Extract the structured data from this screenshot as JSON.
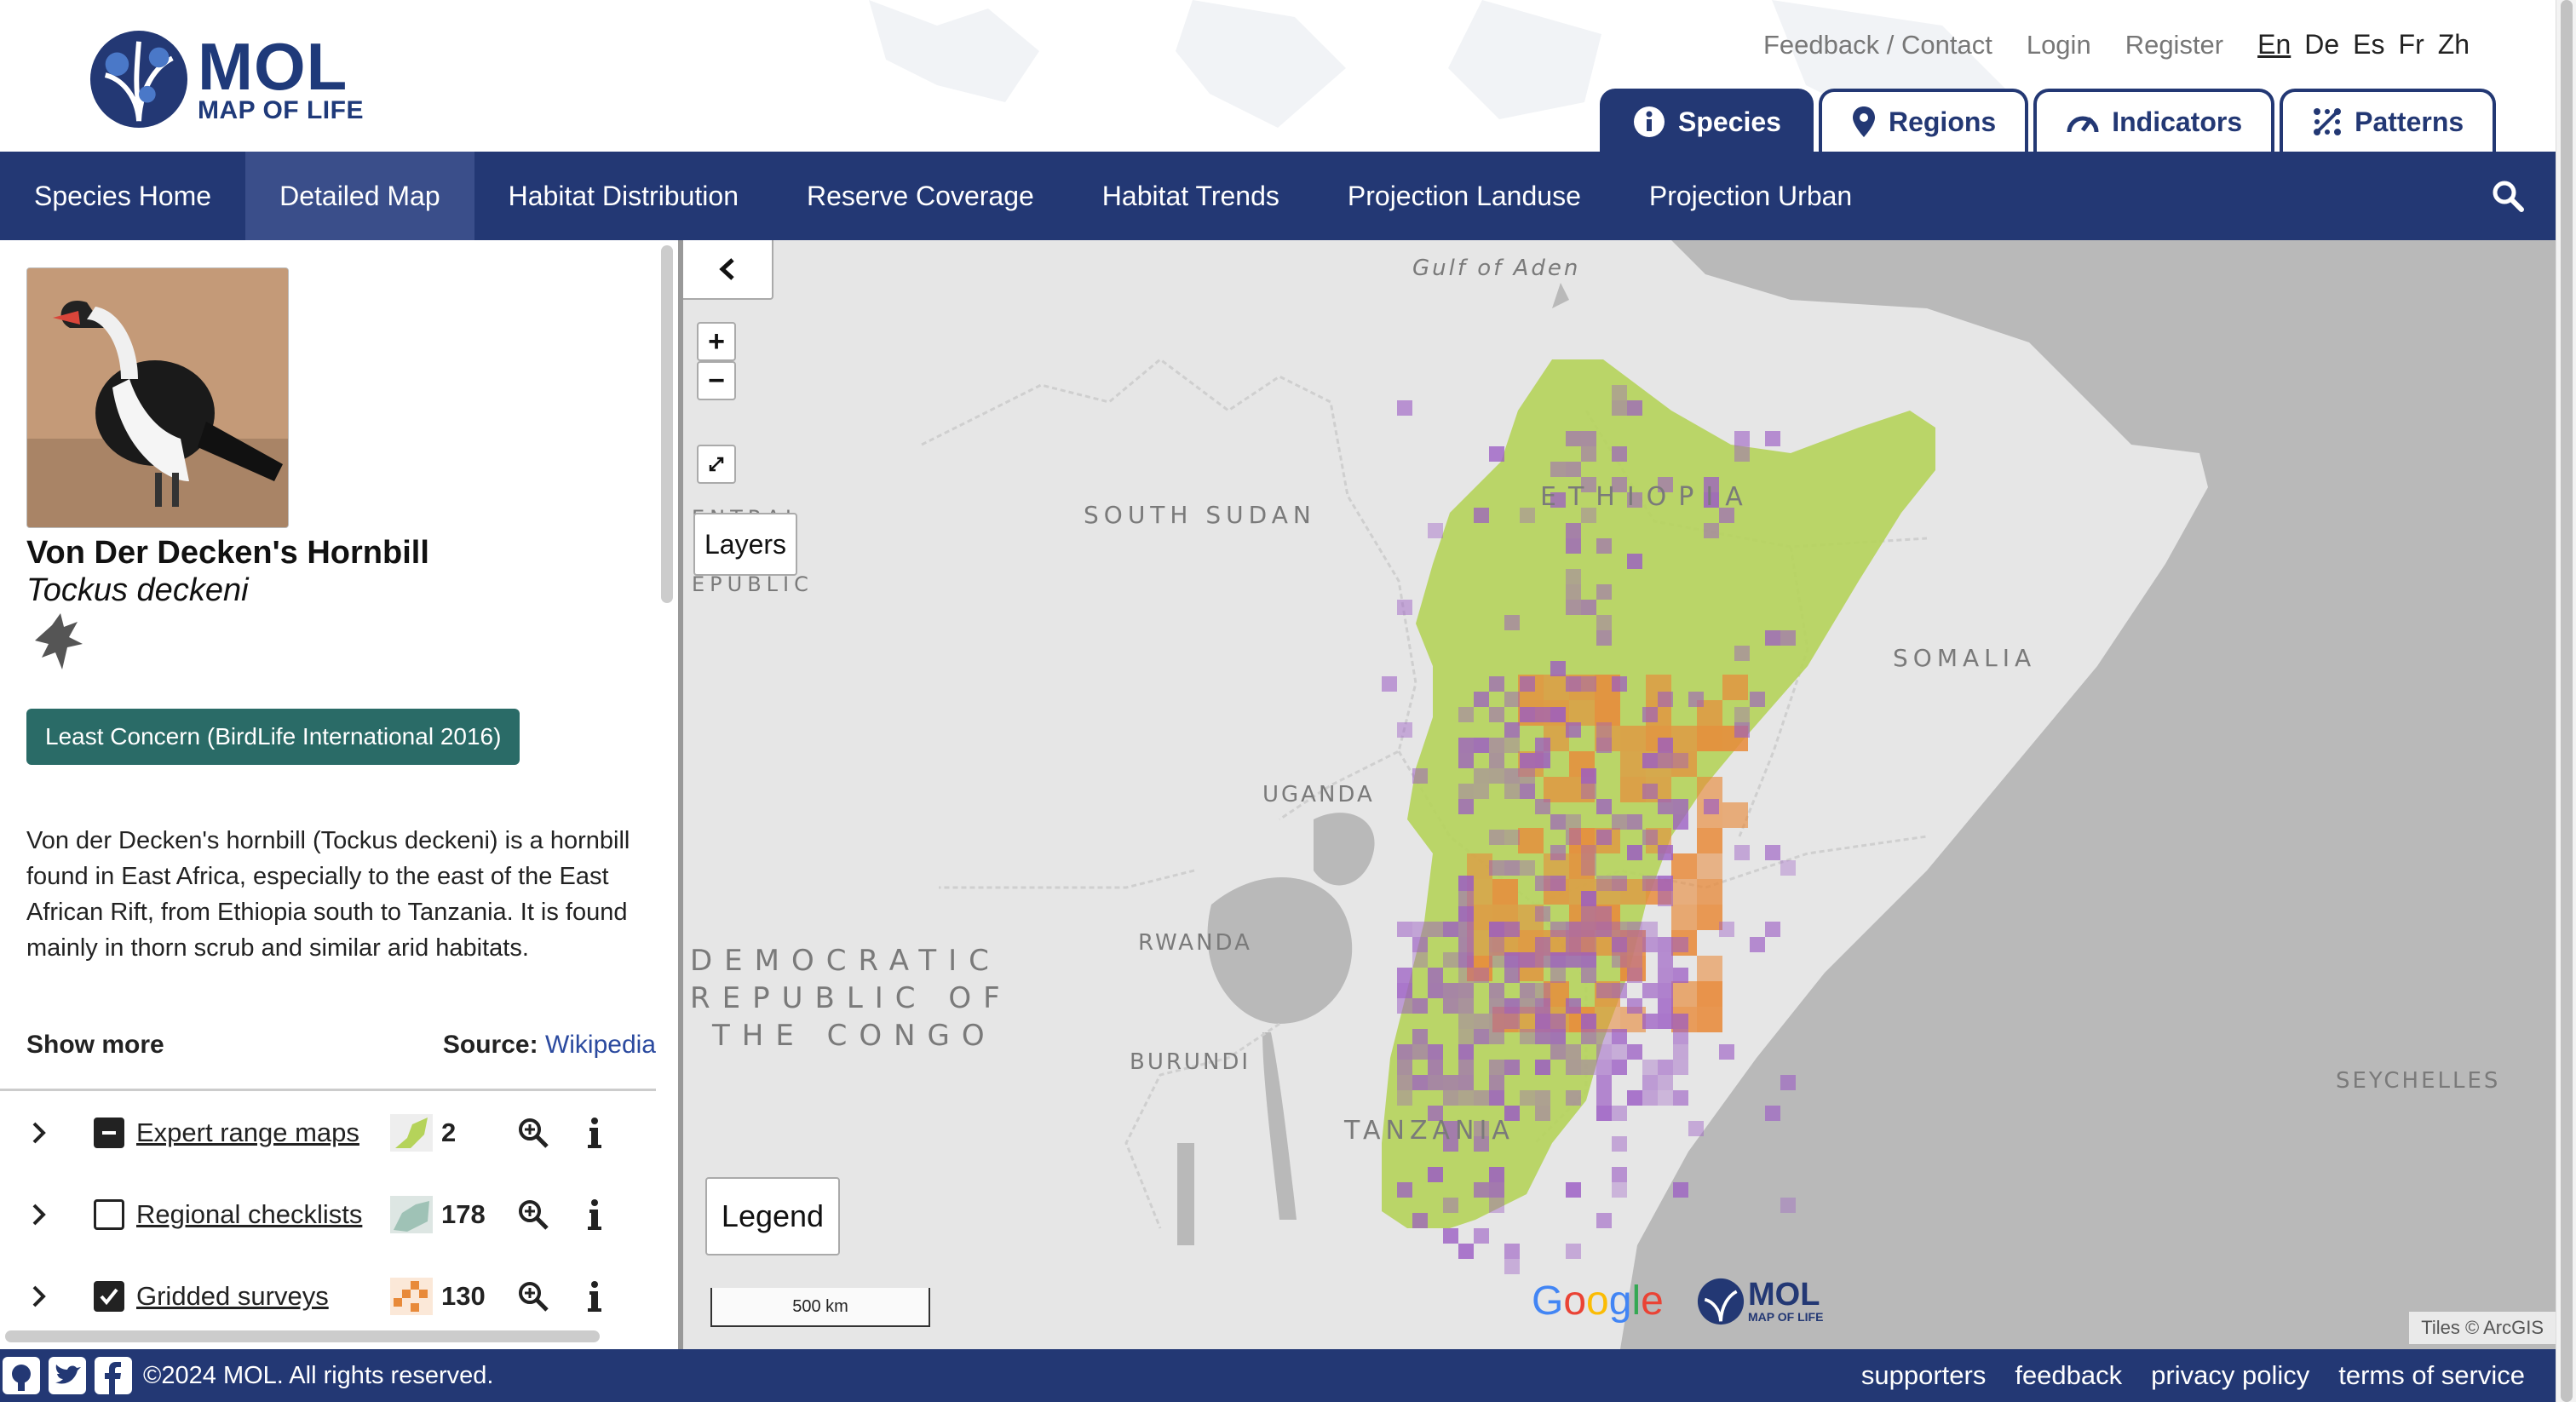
{
  "header": {
    "logo_title": "MOL",
    "logo_subtitle": "MAP OF LIFE",
    "links": [
      "Feedback / Contact",
      "Login",
      "Register"
    ],
    "languages": [
      "En",
      "De",
      "Es",
      "Fr",
      "Zh"
    ],
    "active_language": "En",
    "tabs": [
      {
        "label": "Species",
        "icon": "info-icon",
        "active": true
      },
      {
        "label": "Regions",
        "icon": "map-pin-icon",
        "active": false
      },
      {
        "label": "Indicators",
        "icon": "gauge-icon",
        "active": false
      },
      {
        "label": "Patterns",
        "icon": "patterns-icon",
        "active": false
      }
    ]
  },
  "nav": {
    "items": [
      "Species Home",
      "Detailed Map",
      "Habitat Distribution",
      "Reserve Coverage",
      "Habitat Trends",
      "Projection Landuse",
      "Projection Urban"
    ],
    "active": "Detailed Map"
  },
  "species": {
    "common_name": "Von Der Decken's Hornbill",
    "scientific_name": "Tockus deckeni",
    "status": "Least Concern (BirdLife International 2016)",
    "description": "Von der Decken's hornbill (Tockus deckeni) is a hornbill found in East Africa, especially to the east of the East African Rift, from Ethiopia south to Tanzania. It is found mainly in thorn scrub and similar arid habitats.",
    "show_more": "Show more",
    "source_label": "Source:",
    "source_link": "Wikipedia"
  },
  "layers": [
    {
      "name": "Expert range maps",
      "count": "2",
      "state": "indeterminate"
    },
    {
      "name": "Regional checklists",
      "count": "178",
      "state": "unchecked"
    },
    {
      "name": "Gridded surveys",
      "count": "130",
      "state": "checked"
    }
  ],
  "map": {
    "labels": {
      "south_sudan": "SOUTH SUDAN",
      "ethiopia": "ETHIOPIA",
      "somalia": "SOMALIA",
      "uganda": "UGANDA",
      "rwanda": "RWANDA",
      "burundi": "BURUNDI",
      "drc1": "DEMOCRATIC",
      "drc2": "REPUBLIC OF",
      "drc3": "THE CONGO",
      "tanzania": "TANZANIA",
      "seychelles": "SEYCHELLES",
      "gulf": "Gulf of Aden",
      "car1": "ENTRAL",
      "car2": "EPUBLIC"
    },
    "layers_button": "Layers",
    "legend_button": "Legend",
    "scale": "500 km",
    "google": "Google",
    "attribution": "Tiles © ArcGIS",
    "colors": {
      "range": "#b5d35a",
      "checklist": "#e88a3a",
      "survey": "#9b5cc4",
      "land": "#e6e6e6",
      "water": "#b9b9b9"
    }
  },
  "footer": {
    "copyright": "©2024 MOL. All rights reserved.",
    "links": [
      "supporters",
      "feedback",
      "privacy policy",
      "terms of service"
    ],
    "social_icons": [
      "github-icon",
      "twitter-icon",
      "facebook-icon"
    ]
  }
}
